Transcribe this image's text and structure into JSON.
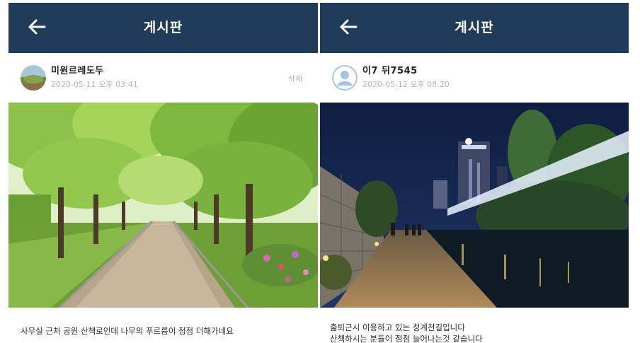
{
  "left_post": {
    "title": "게시판",
    "author": "미원르레도두",
    "date": "2020-05-11 오후 03:41",
    "delete_label": "삭제",
    "caption": "사무실 근처 공원 산책로인데 나무의 푸르름이 점점 더해가네요",
    "photo": "tree-lined brick park path"
  },
  "right_post": {
    "title": "게시판",
    "author": "이7 뒤7545",
    "date": "2020-05-12 오후 08:20",
    "caption_line1": "출퇴근시 이용하고 있는 청계천길입니다",
    "caption_line2": "산책하시는 분들이 점점 늘어나는것 같습니다",
    "photo": "night stream-side walkway"
  },
  "colors": {
    "appbar": "#1f3b57",
    "muted_text": "#b4b4b4"
  },
  "icons": {
    "back": "arrow-left-icon",
    "avatar_default": "person-icon"
  }
}
